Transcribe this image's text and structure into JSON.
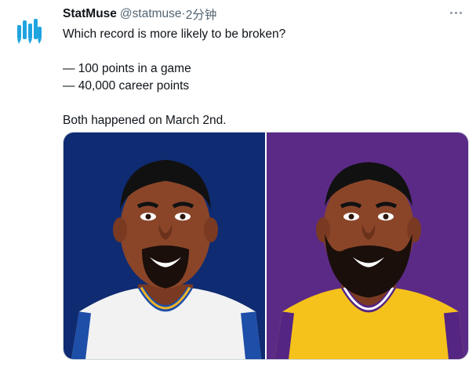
{
  "tweet": {
    "author_name": "StatMuse",
    "author_handle": "@statmuse",
    "separator": "·",
    "timestamp": "2分钟",
    "lines": [
      "Which record is more likely to be broken?",
      "",
      "— 100 points in a game",
      "— 40,000 career points",
      "",
      "Both happened on March 2nd."
    ]
  },
  "icons": {
    "avatar": "statmuse-logo-icon",
    "more": "more-options-icon"
  },
  "colors": {
    "left_bg": "#0f2b72",
    "right_bg": "#5b2a86",
    "warriors_blue": "#1d4ea8",
    "warriors_gold": "#f0b429",
    "lakers_gold": "#f5c21b",
    "lakers_purple": "#552583",
    "logo_blue": "#1fa4e0"
  },
  "media": {
    "left_image": "cartoon-portrait-warriors-jersey",
    "right_image": "cartoon-portrait-lakers-jersey"
  }
}
